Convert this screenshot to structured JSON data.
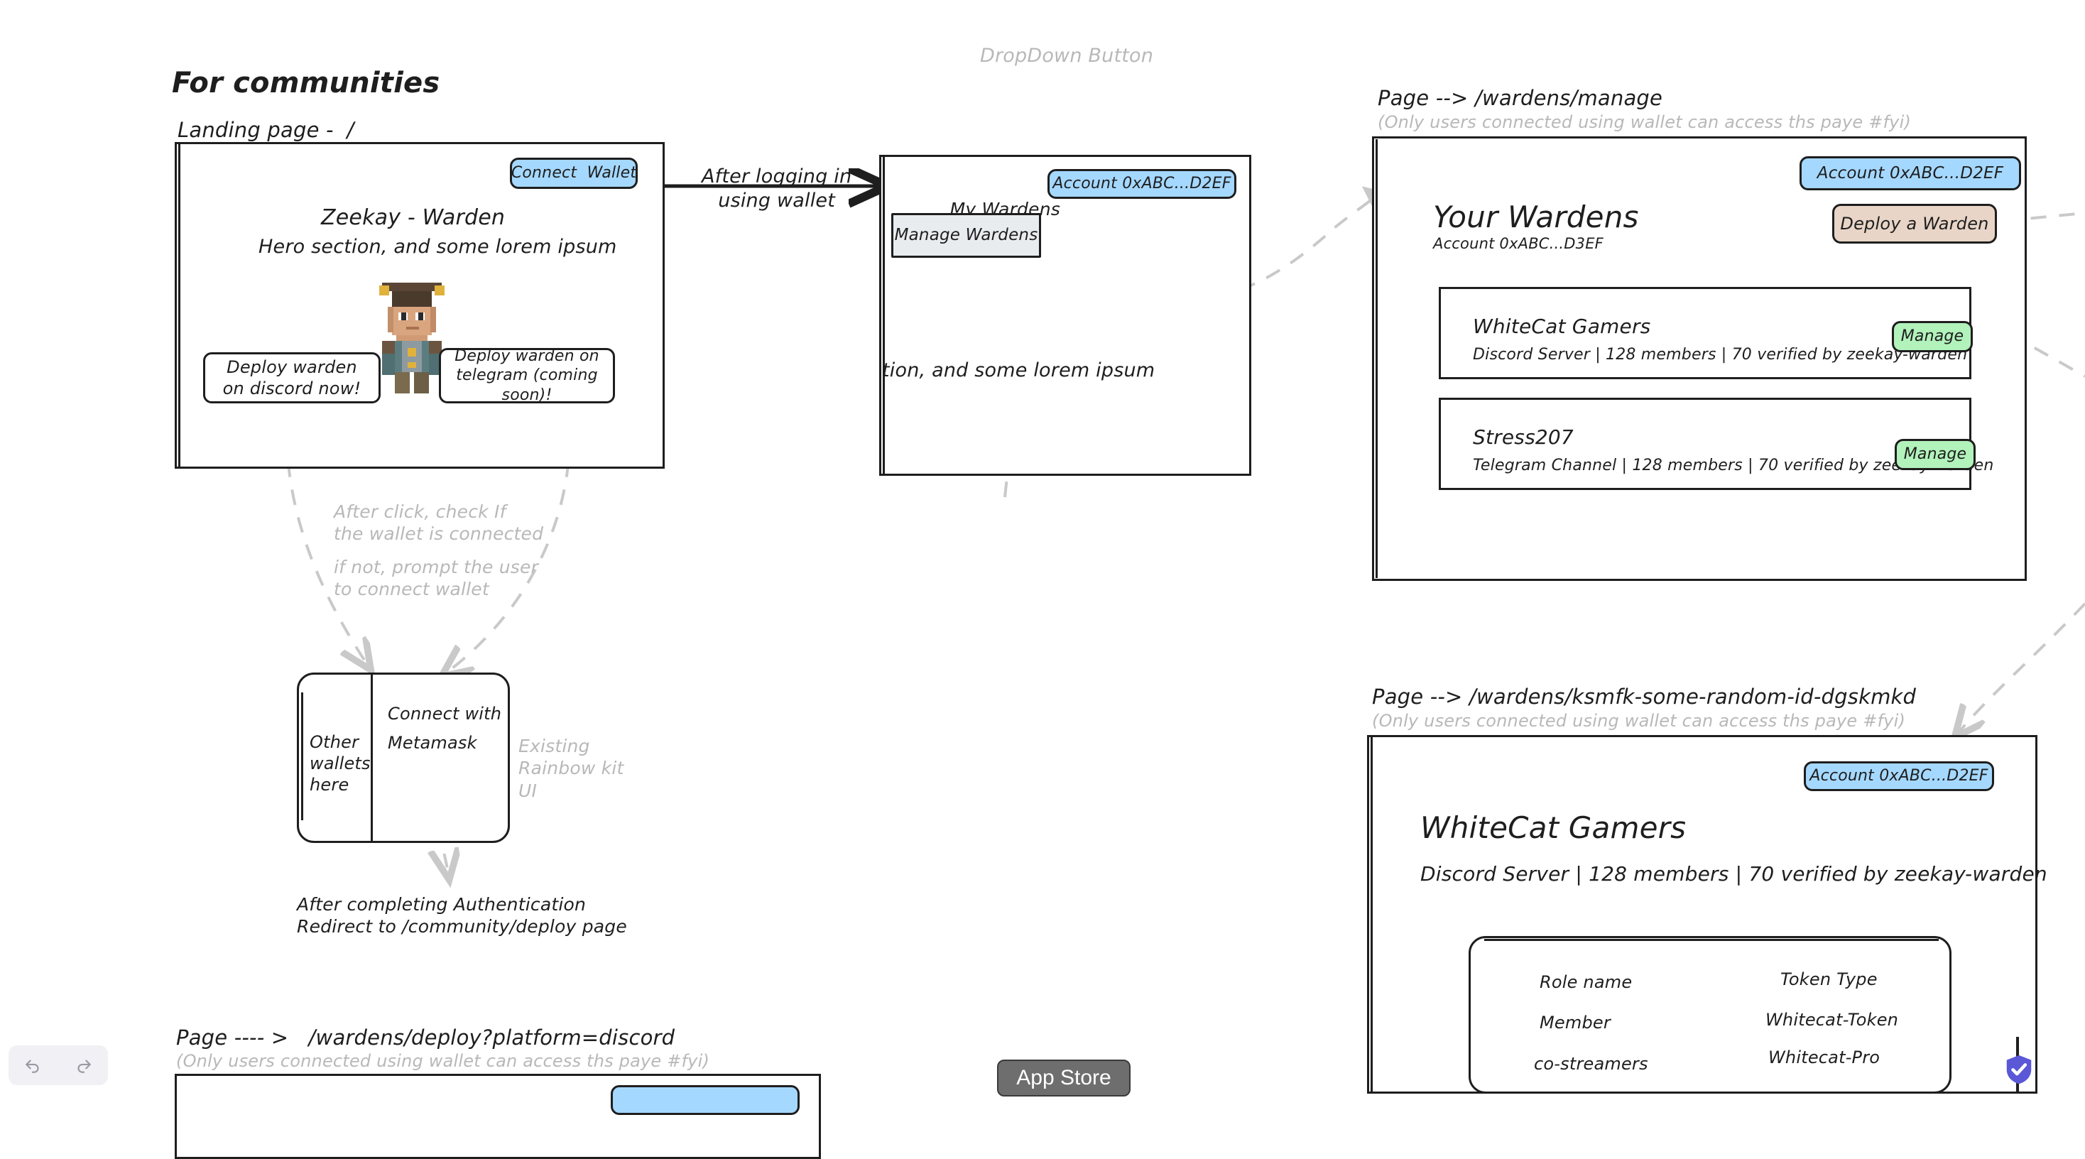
{
  "board": {
    "section_title": "For communities"
  },
  "landing": {
    "page_label": "Landing page -  /",
    "connect_wallet": "Connect  Wallet",
    "hero_title": "Zeekay - Warden",
    "hero_sub": "Hero section, and some lorem ipsum",
    "cta_discord": "Deploy warden\non discord now!",
    "cta_telegram": "Deploy warden on\ntelegram (coming soon)!",
    "avatar_name": "minecraft-warden-avatar"
  },
  "flow": {
    "after_login": "After logging in\nusing wallet",
    "dropdown_button_note": "DropDown Button",
    "after_click_note": "After click, check If\nthe wallet is connected",
    "if_not_note": "if not, prompt the user\nto connect wallet",
    "rainbow_kit_note": "Existing\nRainbow kit\nUI",
    "after_auth_note": "After completing Authentication\nRedirect to /community/deploy page"
  },
  "logged_in": {
    "my_wardens": "My Wardens",
    "chevron": "⌄",
    "account_badge": "Account 0xABC...D2EF",
    "manage_wardens": "Manage Wardens",
    "lorem": "tion, and some lorem ipsum"
  },
  "wallet_modal": {
    "other_wallets": "Other\nwallets\nhere",
    "connect_with": "Connect with",
    "provider": "Metamask"
  },
  "manage_page": {
    "page_label": "Page --> /wardens/manage",
    "access_note": "(Only users connected using wallet can access ths paye #fyi)",
    "title": "Your Wardens",
    "account_sub": "Account 0xABC...D3EF",
    "account_badge": "Account 0xABC...D2EF",
    "deploy_button": "Deploy a Warden",
    "wardens": [
      {
        "name": "WhiteCat Gamers",
        "meta": "Discord Server | 128 members | 70 verified by zeekay-warden",
        "action": "Manage"
      },
      {
        "name": "Stress207",
        "meta": "Telegram Channel | 128 members | 70 verified by zeekay-warden",
        "action": "Manage"
      }
    ]
  },
  "detail_page": {
    "page_label": "Page --> /wardens/ksmfk-some-random-id-dgskmkd",
    "access_note": "(Only users connected using wallet can access ths paye #fyi)",
    "account_badge": "Account 0xABC...D2EF",
    "title": "WhiteCat Gamers",
    "meta": "Discord Server | 128 members | 70 verified by zeekay-warden",
    "table": {
      "headers": [
        "Role name",
        "Token Type"
      ],
      "rows": [
        [
          "Member",
          "Whitecat-Token"
        ],
        [
          "co-streamers",
          "Whitecat-Pro"
        ]
      ]
    }
  },
  "deploy_page": {
    "page_label": "Page ---- >   /wardens/deploy?platform=discord",
    "access_note": "(Only users connected using wallet can access ths paye #fyi)"
  },
  "chrome": {
    "undo": "undo-icon",
    "redo": "redo-icon",
    "app_store": "App Store",
    "shield_check": "shield-check-icon"
  },
  "colors": {
    "ink": "#1e1e1e",
    "ghost": "#b8b8b8",
    "blue": "#a5d8ff",
    "green": "#b2f2bb",
    "tan": "#e8d5c7",
    "grey": "#e9ecef",
    "shield": "#5a58d6"
  }
}
